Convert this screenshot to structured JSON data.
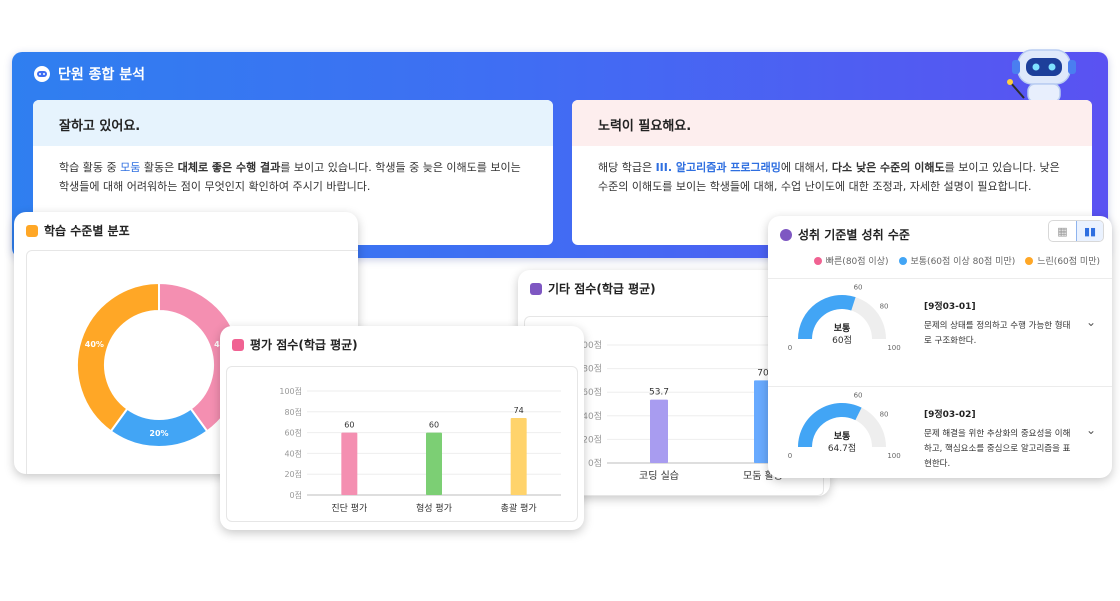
{
  "banner": {
    "title": "단원 종합 분석",
    "good": {
      "heading": "잘하고 있어요.",
      "p1": "학습 활동 중 ",
      "hl": "모둠",
      "p2": " 활동은 ",
      "b1": "대체로 좋은 수행 결과",
      "p3": "를 보이고 있습니다. 학생들 중 늦은 이해도를 보이는 학생들에 대해 어려워하는 점이 무엇인지 확인하여 주시기 바랍니다."
    },
    "need": {
      "heading": "노력이 필요해요.",
      "p1": "해당 학급은 ",
      "hl": "III. 알고리즘과 프로그래밍",
      "p2": "에 대해서, ",
      "b1": "다소 낮은 수준의 이해도",
      "p3": "를 보이고 있습니다. 낮은 수준의 이해도를 보이는 학생들에 대해, 수업 난이도에 대한 조정과, 자세한 설명이 필요합니다."
    }
  },
  "distribution": {
    "title": "학습 수준별 분포",
    "chart_data": {
      "type": "pie",
      "slices": [
        {
          "value": 40,
          "label": "40%",
          "color": "#f48fb1"
        },
        {
          "value": 20,
          "label": "20%",
          "color": "#42a5f5"
        },
        {
          "value": 40,
          "label": "40%",
          "color": "#ffa726"
        }
      ]
    }
  },
  "evaluation": {
    "title": "평가 점수(학급 평균)",
    "chart_data": {
      "type": "bar",
      "categories": [
        "진단 평가",
        "형성 평가",
        "총괄 평가"
      ],
      "values": [
        60,
        60,
        74
      ],
      "colors": [
        "#f48fb1",
        "#7ccf74",
        "#ffd36b"
      ],
      "yticks": [
        "0점",
        "20점",
        "40점",
        "60점",
        "80점",
        "100점"
      ],
      "ylim": [
        0,
        100
      ]
    }
  },
  "other": {
    "title": "기타 점수(학급 평균)",
    "chart_data": {
      "type": "bar",
      "categories": [
        "코딩 실습",
        "모둠 활동"
      ],
      "values": [
        53.7,
        70
      ],
      "colors": [
        "#a89cf0",
        "#68aaff"
      ],
      "yticks": [
        "0점",
        "20점",
        "40점",
        "60점",
        "80점",
        "100점"
      ],
      "ylim": [
        0,
        100
      ]
    }
  },
  "achievement": {
    "title": "성취 기준별 성취 수준",
    "legend": [
      {
        "label": "빠른(80점 이상)",
        "color": "#f06292"
      },
      {
        "label": "보통(60점 이상 80점 미만)",
        "color": "#42a5f5"
      },
      {
        "label": "느린(60점 미만)",
        "color": "#ffa726"
      }
    ],
    "toggle_icons": [
      "table-icon",
      "bar-chart-icon"
    ],
    "standards": [
      {
        "code": "[9정03-01]",
        "desc": "문제의 상태를 정의하고 수행 가능한 형태로 구조화한다.",
        "level": "보통",
        "score": 60,
        "score_text": "60점",
        "ticks": [
          "0",
          "60",
          "80",
          "100"
        ]
      },
      {
        "code": "[9정03-02]",
        "desc": "문제 해결을 위한 추상화의 중요성을 이해하고, 핵심요소를 중심으로 알고리즘을 표현한다.",
        "level": "보통",
        "score": 64.7,
        "score_text": "64.7점",
        "ticks": [
          "0",
          "60",
          "80",
          "100"
        ]
      }
    ]
  }
}
